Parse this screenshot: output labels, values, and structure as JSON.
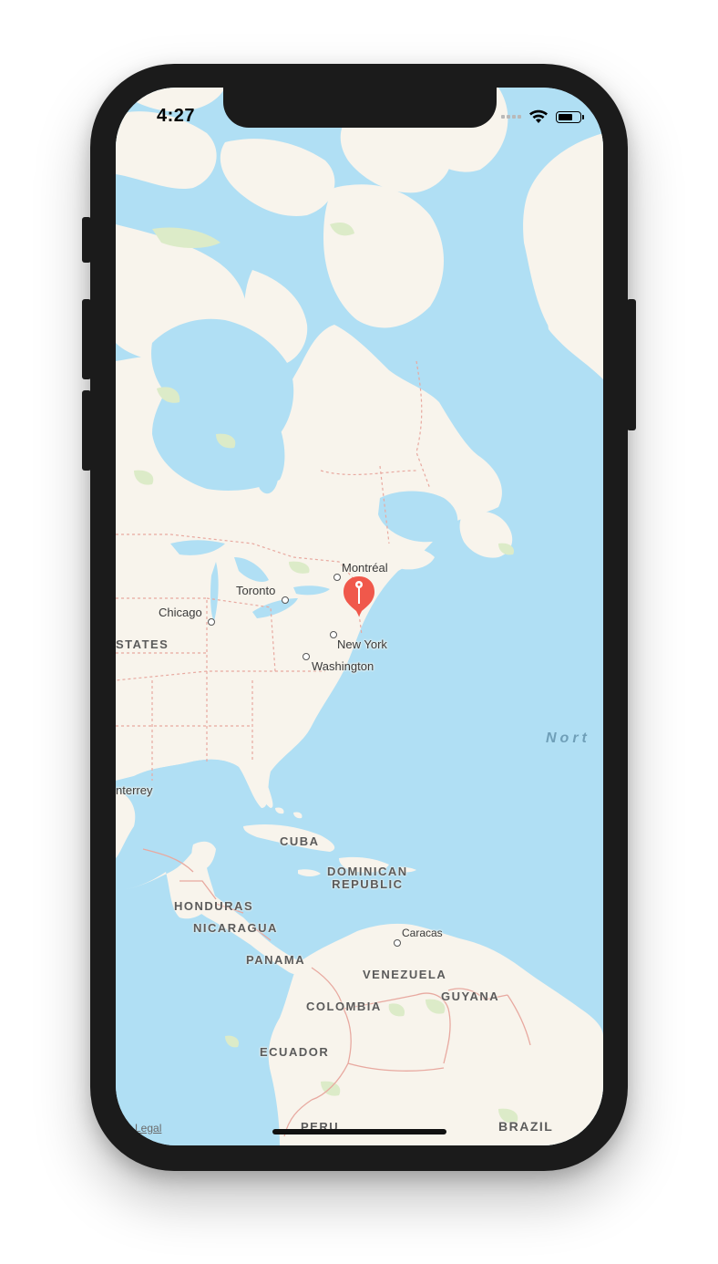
{
  "status_bar": {
    "time": "4:27"
  },
  "map": {
    "cities": [
      {
        "name": "Montréal"
      },
      {
        "name": "Toronto"
      },
      {
        "name": "Chicago"
      },
      {
        "name": "New York"
      },
      {
        "name": "Washington"
      },
      {
        "name": "nterrey"
      },
      {
        "name": "Caracas"
      }
    ],
    "countries": [
      {
        "name": "STATES"
      },
      {
        "name": "CUBA"
      },
      {
        "name": "DOMINICAN\nREPUBLIC"
      },
      {
        "name": "HONDURAS"
      },
      {
        "name": "NICARAGUA"
      },
      {
        "name": "PANAMA"
      },
      {
        "name": "VENEZUELA"
      },
      {
        "name": "GUYANA"
      },
      {
        "name": "COLOMBIA"
      },
      {
        "name": "ECUADOR"
      },
      {
        "name": "PERU"
      },
      {
        "name": "BRAZIL"
      }
    ],
    "ocean_label": "Nort",
    "legal": "Legal",
    "pin_icon": "map-pin-icon",
    "colors": {
      "water": "#b0dff4",
      "land": "#f8f4ec",
      "park": "#dcebc8",
      "border": "#e8a9a0",
      "pin": "#f0584b"
    }
  }
}
